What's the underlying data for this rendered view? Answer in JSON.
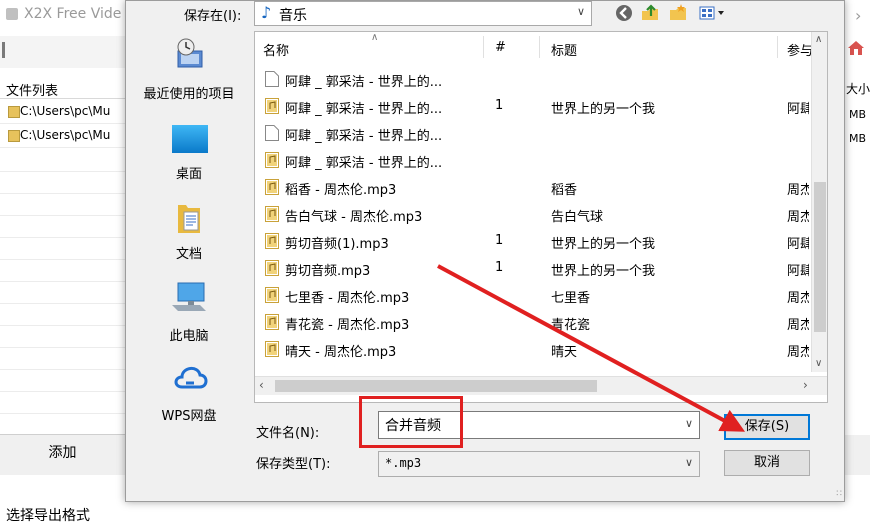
{
  "background_app": {
    "title": "X2X Free Vide",
    "file_list_label": "文件列表",
    "rows": [
      "C:\\Users\\pc\\Mu",
      "C:\\Users\\pc\\Mu"
    ],
    "size_col": "大小",
    "mb_values": [
      "MB",
      "MB"
    ],
    "add_button": "添加",
    "export_label": "选择导出格式"
  },
  "dialog": {
    "save_in_label": "保存在(I):",
    "save_in_value": "音乐",
    "places": [
      {
        "label": "最近使用的项目",
        "icon": "recent-places-icon"
      },
      {
        "label": "桌面",
        "icon": "desktop-icon"
      },
      {
        "label": "文档",
        "icon": "documents-icon"
      },
      {
        "label": "此电脑",
        "icon": "this-pc-icon"
      },
      {
        "label": "WPS网盘",
        "icon": "wps-cloud-icon"
      }
    ],
    "columns": {
      "name": "名称",
      "num": "#",
      "title": "标题",
      "artist": "参与"
    },
    "files": [
      {
        "name": "阿肆 _ 郭采洁 - 世界上的...",
        "num": "",
        "title": "",
        "artist": "",
        "icon": "blank-file-icon"
      },
      {
        "name": "阿肆 _ 郭采洁 - 世界上的...",
        "num": "1",
        "title": "世界上的另一个我",
        "artist": "阿肆",
        "icon": "audio-file-icon"
      },
      {
        "name": "阿肆 _ 郭采洁 - 世界上的...",
        "num": "",
        "title": "",
        "artist": "",
        "icon": "blank-file-icon"
      },
      {
        "name": "阿肆 _ 郭采洁 - 世界上的...",
        "num": "",
        "title": "",
        "artist": "",
        "icon": "audio-file-icon"
      },
      {
        "name": "稻香 - 周杰伦.mp3",
        "num": "",
        "title": "稻香",
        "artist": "周杰",
        "icon": "audio-file-icon"
      },
      {
        "name": "告白气球 - 周杰伦.mp3",
        "num": "",
        "title": "告白气球",
        "artist": "周杰",
        "icon": "audio-file-icon"
      },
      {
        "name": "剪切音频(1).mp3",
        "num": "1",
        "title": "世界上的另一个我",
        "artist": "阿肆",
        "icon": "audio-file-icon"
      },
      {
        "name": "剪切音频.mp3",
        "num": "1",
        "title": "世界上的另一个我",
        "artist": "阿肆",
        "icon": "audio-file-icon"
      },
      {
        "name": "七里香 - 周杰伦.mp3",
        "num": "",
        "title": "七里香",
        "artist": "周杰",
        "icon": "audio-file-icon"
      },
      {
        "name": "青花瓷 - 周杰伦.mp3",
        "num": "",
        "title": "青花瓷",
        "artist": "周杰",
        "icon": "audio-file-icon"
      },
      {
        "name": "晴天 - 周杰伦.mp3",
        "num": "",
        "title": "晴天",
        "artist": "周杰",
        "icon": "audio-file-icon"
      }
    ],
    "filename_label": "文件名(N):",
    "filename_value": "合并音频",
    "filetype_label": "保存类型(T):",
    "filetype_value": "*.mp3",
    "save_button": "保存(S)",
    "cancel_button": "取消"
  },
  "annotation_color": "#e02020"
}
